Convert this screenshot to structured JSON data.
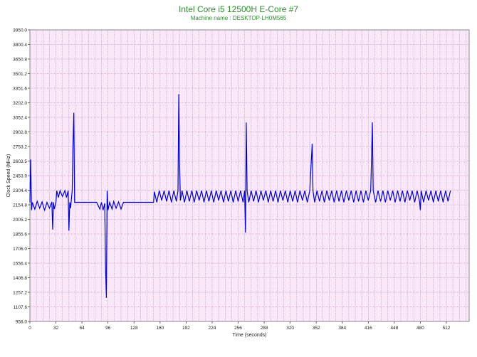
{
  "chart_data": {
    "type": "line",
    "title": "Intel Core i5 12500H E-Core #7",
    "subtitle": "Machine name : DESKTOP-LH0M565",
    "xlabel": "Time (seconds)",
    "ylabel": "Clock Speed (MHz)",
    "xlim": [
      0,
      540
    ],
    "ylim": [
      958.0,
      3950.0
    ],
    "xticks": [
      "0",
      "32",
      "64",
      "96",
      "128",
      "160",
      "192",
      "224",
      "256",
      "288",
      "320",
      "352",
      "384",
      "416",
      "448",
      "480",
      "512"
    ],
    "yticks": [
      "958.0",
      "1107.6",
      "1257.2",
      "1406.8",
      "1556.4",
      "1706.0",
      "1855.6",
      "2005.2",
      "2154.8",
      "2304.4",
      "2453.9",
      "2603.5",
      "2753.2",
      "2902.8",
      "3052.4",
      "3202.0",
      "3351.6",
      "3501.2",
      "3650.8",
      "3800.4",
      "3950.0"
    ],
    "grid": true,
    "colors": {
      "line": "#0000cc",
      "plot_bg": "#f8e8f8",
      "grid": "#bb88bb",
      "title": "#2e8b2e"
    },
    "series": [
      {
        "values_sampled": [
          [
            0,
            2180
          ],
          [
            1,
            2620
          ],
          [
            2,
            2100
          ],
          [
            3,
            2180
          ],
          [
            6,
            2110
          ],
          [
            9,
            2190
          ],
          [
            12,
            2120
          ],
          [
            15,
            2185
          ],
          [
            18,
            2100
          ],
          [
            21,
            2180
          ],
          [
            24,
            2120
          ],
          [
            27,
            2185
          ],
          [
            28,
            1900
          ],
          [
            29,
            2180
          ],
          [
            30,
            2110
          ],
          [
            32,
            2185
          ],
          [
            33,
            2300
          ],
          [
            35,
            2230
          ],
          [
            37,
            2300
          ],
          [
            40,
            2240
          ],
          [
            43,
            2300
          ],
          [
            45,
            2230
          ],
          [
            47,
            2300
          ],
          [
            48,
            1890
          ],
          [
            49,
            2180
          ],
          [
            50,
            2120
          ],
          [
            52,
            2300
          ],
          [
            53,
            2800
          ],
          [
            54,
            3100
          ],
          [
            55,
            2180
          ],
          [
            58,
            2180
          ],
          [
            62,
            2180
          ],
          [
            66,
            2180
          ],
          [
            70,
            2180
          ],
          [
            74,
            2180
          ],
          [
            78,
            2180
          ],
          [
            82,
            2180
          ],
          [
            86,
            2110
          ],
          [
            88,
            2180
          ],
          [
            90,
            2100
          ],
          [
            92,
            2170
          ],
          [
            93,
            1500
          ],
          [
            94,
            1200
          ],
          [
            95,
            2300
          ],
          [
            96,
            2100
          ],
          [
            98,
            2180
          ],
          [
            101,
            2110
          ],
          [
            103,
            2190
          ],
          [
            106,
            2120
          ],
          [
            109,
            2185
          ],
          [
            112,
            2110
          ],
          [
            115,
            2180
          ],
          [
            118,
            2180
          ],
          [
            124,
            2180
          ],
          [
            130,
            2180
          ],
          [
            136,
            2180
          ],
          [
            142,
            2180
          ],
          [
            148,
            2180
          ],
          [
            152,
            2180
          ],
          [
            153,
            2290
          ],
          [
            156,
            2180
          ],
          [
            159,
            2300
          ],
          [
            162,
            2200
          ],
          [
            165,
            2300
          ],
          [
            168,
            2190
          ],
          [
            171,
            2300
          ],
          [
            174,
            2180
          ],
          [
            177,
            2300
          ],
          [
            180,
            2190
          ],
          [
            182,
            2300
          ],
          [
            183,
            3290
          ],
          [
            184,
            2600
          ],
          [
            185,
            2200
          ],
          [
            187,
            2300
          ],
          [
            190,
            2180
          ],
          [
            193,
            2300
          ],
          [
            196,
            2190
          ],
          [
            199,
            2300
          ],
          [
            202,
            2180
          ],
          [
            205,
            2300
          ],
          [
            208,
            2200
          ],
          [
            211,
            2300
          ],
          [
            214,
            2180
          ],
          [
            217,
            2300
          ],
          [
            220,
            2190
          ],
          [
            223,
            2300
          ],
          [
            226,
            2180
          ],
          [
            229,
            2300
          ],
          [
            232,
            2200
          ],
          [
            235,
            2300
          ],
          [
            238,
            2180
          ],
          [
            241,
            2300
          ],
          [
            244,
            2190
          ],
          [
            247,
            2300
          ],
          [
            250,
            2180
          ],
          [
            253,
            2300
          ],
          [
            256,
            2190
          ],
          [
            259,
            2300
          ],
          [
            262,
            2180
          ],
          [
            264,
            2300
          ],
          [
            265,
            1870
          ],
          [
            266,
            3000
          ],
          [
            267,
            2300
          ],
          [
            269,
            2180
          ],
          [
            272,
            2300
          ],
          [
            275,
            2190
          ],
          [
            278,
            2300
          ],
          [
            281,
            2180
          ],
          [
            284,
            2300
          ],
          [
            287,
            2200
          ],
          [
            290,
            2300
          ],
          [
            293,
            2180
          ],
          [
            296,
            2300
          ],
          [
            299,
            2190
          ],
          [
            302,
            2300
          ],
          [
            305,
            2180
          ],
          [
            308,
            2300
          ],
          [
            311,
            2200
          ],
          [
            314,
            2300
          ],
          [
            317,
            2180
          ],
          [
            320,
            2300
          ],
          [
            323,
            2190
          ],
          [
            326,
            2300
          ],
          [
            329,
            2180
          ],
          [
            332,
            2300
          ],
          [
            335,
            2200
          ],
          [
            338,
            2300
          ],
          [
            341,
            2180
          ],
          [
            344,
            2300
          ],
          [
            346,
            2620
          ],
          [
            347,
            2780
          ],
          [
            348,
            2300
          ],
          [
            350,
            2180
          ],
          [
            353,
            2300
          ],
          [
            356,
            2190
          ],
          [
            359,
            2300
          ],
          [
            362,
            2180
          ],
          [
            365,
            2300
          ],
          [
            368,
            2200
          ],
          [
            371,
            2300
          ],
          [
            374,
            2180
          ],
          [
            377,
            2300
          ],
          [
            380,
            2190
          ],
          [
            383,
            2300
          ],
          [
            386,
            2180
          ],
          [
            389,
            2300
          ],
          [
            392,
            2200
          ],
          [
            395,
            2300
          ],
          [
            398,
            2180
          ],
          [
            401,
            2300
          ],
          [
            404,
            2190
          ],
          [
            407,
            2300
          ],
          [
            410,
            2180
          ],
          [
            413,
            2300
          ],
          [
            416,
            2200
          ],
          [
            419,
            2300
          ],
          [
            420,
            2640
          ],
          [
            421,
            3000
          ],
          [
            422,
            2300
          ],
          [
            425,
            2180
          ],
          [
            428,
            2300
          ],
          [
            431,
            2190
          ],
          [
            434,
            2300
          ],
          [
            437,
            2180
          ],
          [
            440,
            2300
          ],
          [
            443,
            2200
          ],
          [
            446,
            2300
          ],
          [
            449,
            2180
          ],
          [
            452,
            2300
          ],
          [
            455,
            2190
          ],
          [
            458,
            2300
          ],
          [
            461,
            2180
          ],
          [
            464,
            2300
          ],
          [
            467,
            2200
          ],
          [
            470,
            2300
          ],
          [
            473,
            2180
          ],
          [
            476,
            2300
          ],
          [
            479,
            2190
          ],
          [
            480,
            2100
          ],
          [
            481,
            2300
          ],
          [
            484,
            2180
          ],
          [
            487,
            2300
          ],
          [
            490,
            2200
          ],
          [
            493,
            2300
          ],
          [
            496,
            2180
          ],
          [
            499,
            2300
          ],
          [
            502,
            2190
          ],
          [
            505,
            2300
          ],
          [
            508,
            2180
          ],
          [
            511,
            2300
          ],
          [
            514,
            2190
          ],
          [
            517,
            2300
          ]
        ]
      }
    ]
  }
}
